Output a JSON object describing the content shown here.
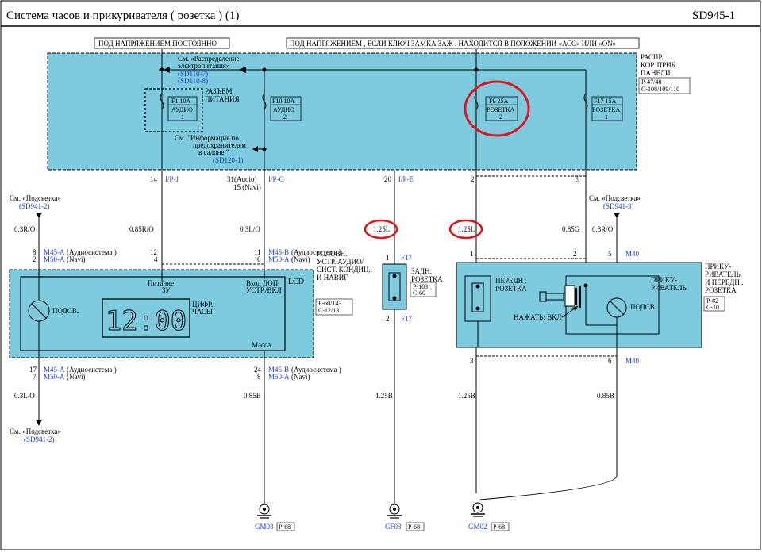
{
  "header": {
    "title": "Система   часов   и прикуривателя   ( розетка  ) (1)",
    "code": "SD945-1"
  },
  "power": {
    "constant": "ПОД НАПРЯЖЕНИЕМ  ПОСТОЯННО",
    "acc_on": "ПОД НАПРЯЖЕНИЕМ , ЕСЛИ КЛЮЧ ЗАМКА ЗАЖ . НАХОДИТСЯ В ПОЛОЖЕНИИ  «АСС» ИЛИ «ON»"
  },
  "junction_box": {
    "name_lines": [
      "РАСПР.",
      "КОР. ПРИБ .",
      "ПАНЕЛИ"
    ],
    "connectors": [
      "P-47/48",
      "C-108/109/110"
    ],
    "ref_dist_lines": [
      "См. «Распределение",
      "электропитания»",
      "(SD110-7)",
      "(SD110-8)"
    ],
    "ref_fuse_lines": [
      "См. \"Информация   по",
      "предохранителям",
      "в салоне \"",
      "(SD120-1)"
    ],
    "power_connector_lines": [
      "РАЗЪЕМ",
      "ПИТАНИЯ"
    ],
    "fuses": [
      {
        "id": "F1 10A",
        "lines": [
          "АУДИО",
          "1"
        ]
      },
      {
        "id": "F10 10A",
        "lines": [
          "АУДИО",
          "2"
        ]
      },
      {
        "id": "F9 25A",
        "lines": [
          "РОЗЕТКА",
          "2"
        ]
      },
      {
        "id": "F17 15A",
        "lines": [
          "РОЗЕТКА",
          "1"
        ]
      }
    ]
  },
  "wires": {
    "pin14": "14",
    "ip_j": "I/P-J",
    "pin31": "31(Audio)",
    "pin15": "15 (Navi)",
    "ip_g": "I/P-G",
    "pin20": "20",
    "ip_e": "I/P-E",
    "pin2": "2",
    "pin9": "9",
    "w_03ro": "0.3R/O",
    "w_085ro": "0.85R/O",
    "w_03lo": "0.3L/O",
    "w_125l_a": "1.25L",
    "w_125l_b": "1.25L",
    "w_085g": "0.85G",
    "w_03ro_b": "0.3R/O",
    "w_03lo_b": "0.3L/O",
    "w_085b_a": "0.85B",
    "w_125b_a": "1.25B",
    "w_125b_b": "1.25B",
    "w_085b_b": "0.85B"
  },
  "refs": {
    "illum": "См. «Подсветка»",
    "sd941_2": "(SD941-2)",
    "sd941_3": "(SD941-3)"
  },
  "head_unit": {
    "title_lines": [
      "ГОЛОВН.",
      "УСТР. АУДИО/",
      "СИСТ. КОНДИЦ.",
      "И НАВИГ"
    ],
    "connectors": [
      "P-60/143",
      "C-12/13"
    ],
    "lcd": "LCD",
    "power_lines": [
      "Питание",
      "ЗУ"
    ],
    "aux_lines": [
      "Вход  ДОП.",
      "УСТР./ВКЛ"
    ],
    "clock_lines": [
      "ЦИФР.",
      "ЧАСЫ"
    ],
    "clock_display": "12:00",
    "illum": "ПОДСВ.",
    "ground": "Масса",
    "top_left_pins": [
      "8",
      "2"
    ],
    "top_left_conn": [
      "M45-A",
      "M50-A"
    ],
    "top_left_notes": [
      "(Аудиосистема  )",
      "(Navi)"
    ],
    "top_mid_pins": [
      "12",
      "4"
    ],
    "top_right_pins": [
      "11",
      "6"
    ],
    "top_right_conn": [
      "M45-B",
      "M50-A"
    ],
    "top_right_notes": [
      "(Аудиосистема  )",
      "(Navi)"
    ],
    "bot_left_pins": [
      "17",
      "7"
    ],
    "bot_left_conn": [
      "M45-A",
      "M50-A"
    ],
    "bot_left_notes": [
      "(Аудиосистема )",
      "(Navi)"
    ],
    "bot_right_pins": [
      "24",
      "8"
    ],
    "bot_right_conn": [
      "M45-B",
      "M50-A"
    ],
    "bot_right_notes": [
      "(Аудиосистема  )",
      "(Navi)"
    ]
  },
  "rear_socket": {
    "title_lines": [
      "ЗАДН.",
      "РОЗЕТКА"
    ],
    "connectors": [
      "P-103",
      "C-60"
    ],
    "pin_top": "1",
    "pin_bottom": "2",
    "conn": "F17"
  },
  "lighter": {
    "title_lines": [
      "ПРИКУ-",
      "РИВАТЕЛЬ",
      "И ПЕРЕДН .",
      "РОЗЕТКА"
    ],
    "connectors": [
      "P-82",
      "C-10"
    ],
    "front_lines": [
      "ПЕРЕДН .",
      "РОЗЕТКА"
    ],
    "lighter_lines": [
      "ПРИКУ-",
      "РИВАТЕЛЬ"
    ],
    "press": "НАЖАТЬ: ВКЛ",
    "illum": "ПОДСВ.",
    "pins_top": [
      "1",
      "2",
      "5"
    ],
    "pins_bottom": [
      "3",
      "6"
    ],
    "conn": "M40"
  },
  "grounds": [
    {
      "id": "GM03",
      "conn": "P-68"
    },
    {
      "id": "GF03",
      "conn": "P-68"
    },
    {
      "id": "GM02",
      "conn": "P-68"
    }
  ],
  "colors": {
    "box": "#7ecbe0",
    "ref": "#1a3fd0",
    "highlight": "#e0141e"
  }
}
